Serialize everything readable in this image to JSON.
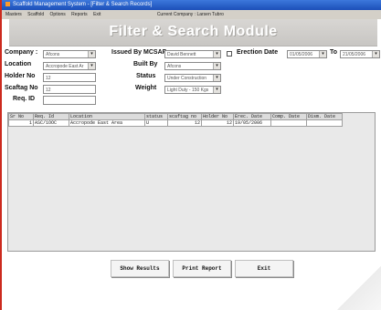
{
  "window": {
    "title": "Scaffold Management System - [Filter & Search Records]"
  },
  "menu": {
    "items": [
      "Masters",
      "Scaffold",
      "Options",
      "Reports",
      "Exit"
    ],
    "company": "Current Company : Larsen Tubro"
  },
  "banner": {
    "title": "Filter & Search Module"
  },
  "form": {
    "company_label": "Company :",
    "company_value": "Afcons",
    "location_label": "Location",
    "location_value": "Accropode East Ar",
    "holder_label": "Holder No",
    "holder_value": "12",
    "scaffno_label": "Scaftag No",
    "scaffno_value": "12",
    "reqid_label": "Req. ID",
    "reqid_value": "",
    "issued_label": "Issued By MCSAP",
    "issued_value": "David Bennett",
    "built_label": "Built By",
    "built_value": "Afcons",
    "status_label": "Status",
    "status_value": "Under Construction",
    "weight_label": "Weight",
    "weight_value": "Light Duty - 150 Kgs",
    "erection_label": "Erection Date",
    "erection_from": "01/05/2006",
    "to_label": "To",
    "erection_to": "21/05/2006"
  },
  "grid": {
    "columns": [
      "Sr No",
      "Req. Id",
      "Location",
      "status",
      "scaftag no",
      "Holder No",
      "Erec. Date",
      "Comp. Date",
      "Dism. Date"
    ],
    "rows": [
      [
        "1",
        "ASC/1OOC",
        "Accropode East Area",
        "U",
        "12",
        "12",
        "19/05/2006",
        "",
        ""
      ]
    ]
  },
  "buttons": {
    "show": "Show Results",
    "print": "Print Report",
    "exit": "Exit"
  }
}
